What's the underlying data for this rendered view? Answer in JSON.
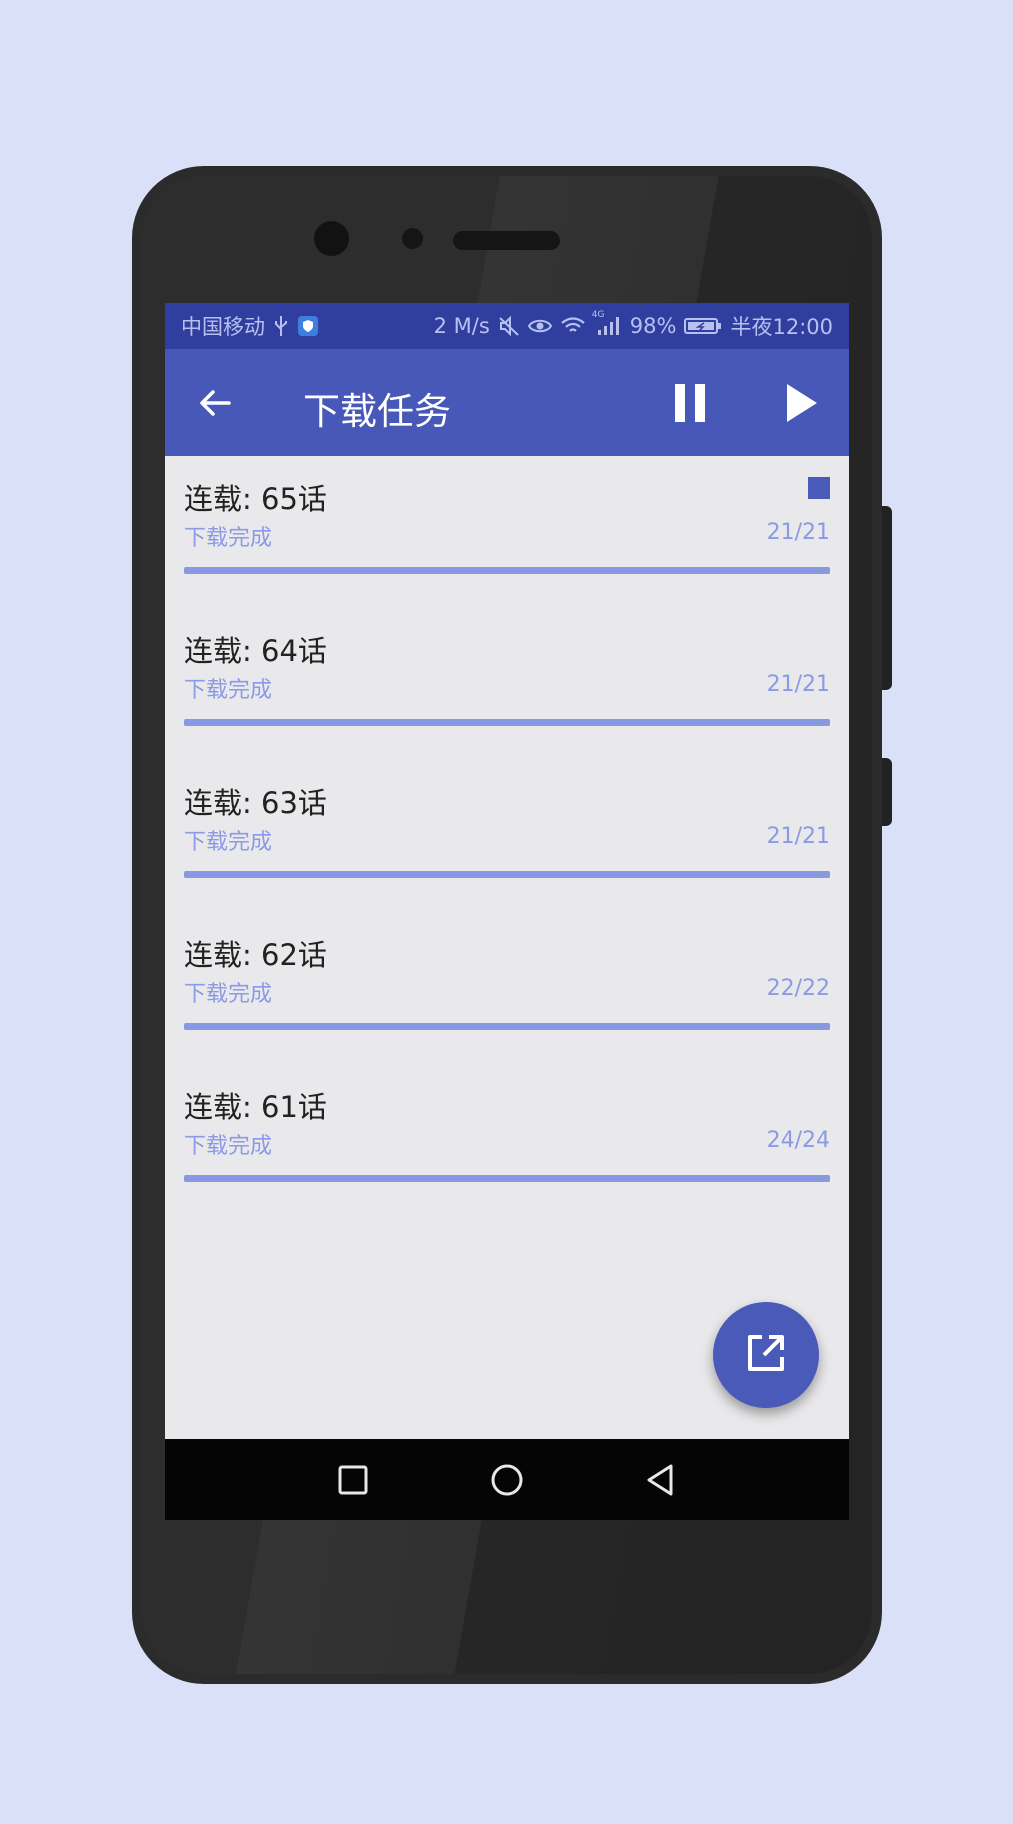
{
  "status_bar": {
    "carrier": "中国移动",
    "speed": "2 M/s",
    "network": "4G",
    "battery": "98%",
    "time": "半夜12:00"
  },
  "toolbar": {
    "title": "下载任务"
  },
  "tasks": [
    {
      "title": "连载: 65话",
      "status": "下载完成",
      "count": "21/21",
      "progress": 1.0,
      "selected": true
    },
    {
      "title": "连载: 64话",
      "status": "下载完成",
      "count": "21/21",
      "progress": 1.0,
      "selected": false
    },
    {
      "title": "连载: 63话",
      "status": "下载完成",
      "count": "21/21",
      "progress": 1.0,
      "selected": false
    },
    {
      "title": "连载: 62话",
      "status": "下载完成",
      "count": "22/22",
      "progress": 1.0,
      "selected": false
    },
    {
      "title": "连载: 61话",
      "status": "下载完成",
      "count": "24/24",
      "progress": 1.0,
      "selected": false
    }
  ],
  "colors": {
    "primary": "#4858b8",
    "primary_dark": "#303f9f",
    "accent_text": "#8a9ae6",
    "progress": "#8799e3",
    "page_bg": "#d9e0f7"
  },
  "icons": {
    "toolbar": [
      "back-arrow-icon",
      "pause-icon",
      "play-icon"
    ],
    "fab": "open-external-icon",
    "navigation": [
      "recent-apps-icon",
      "home-icon",
      "back-icon"
    ]
  }
}
